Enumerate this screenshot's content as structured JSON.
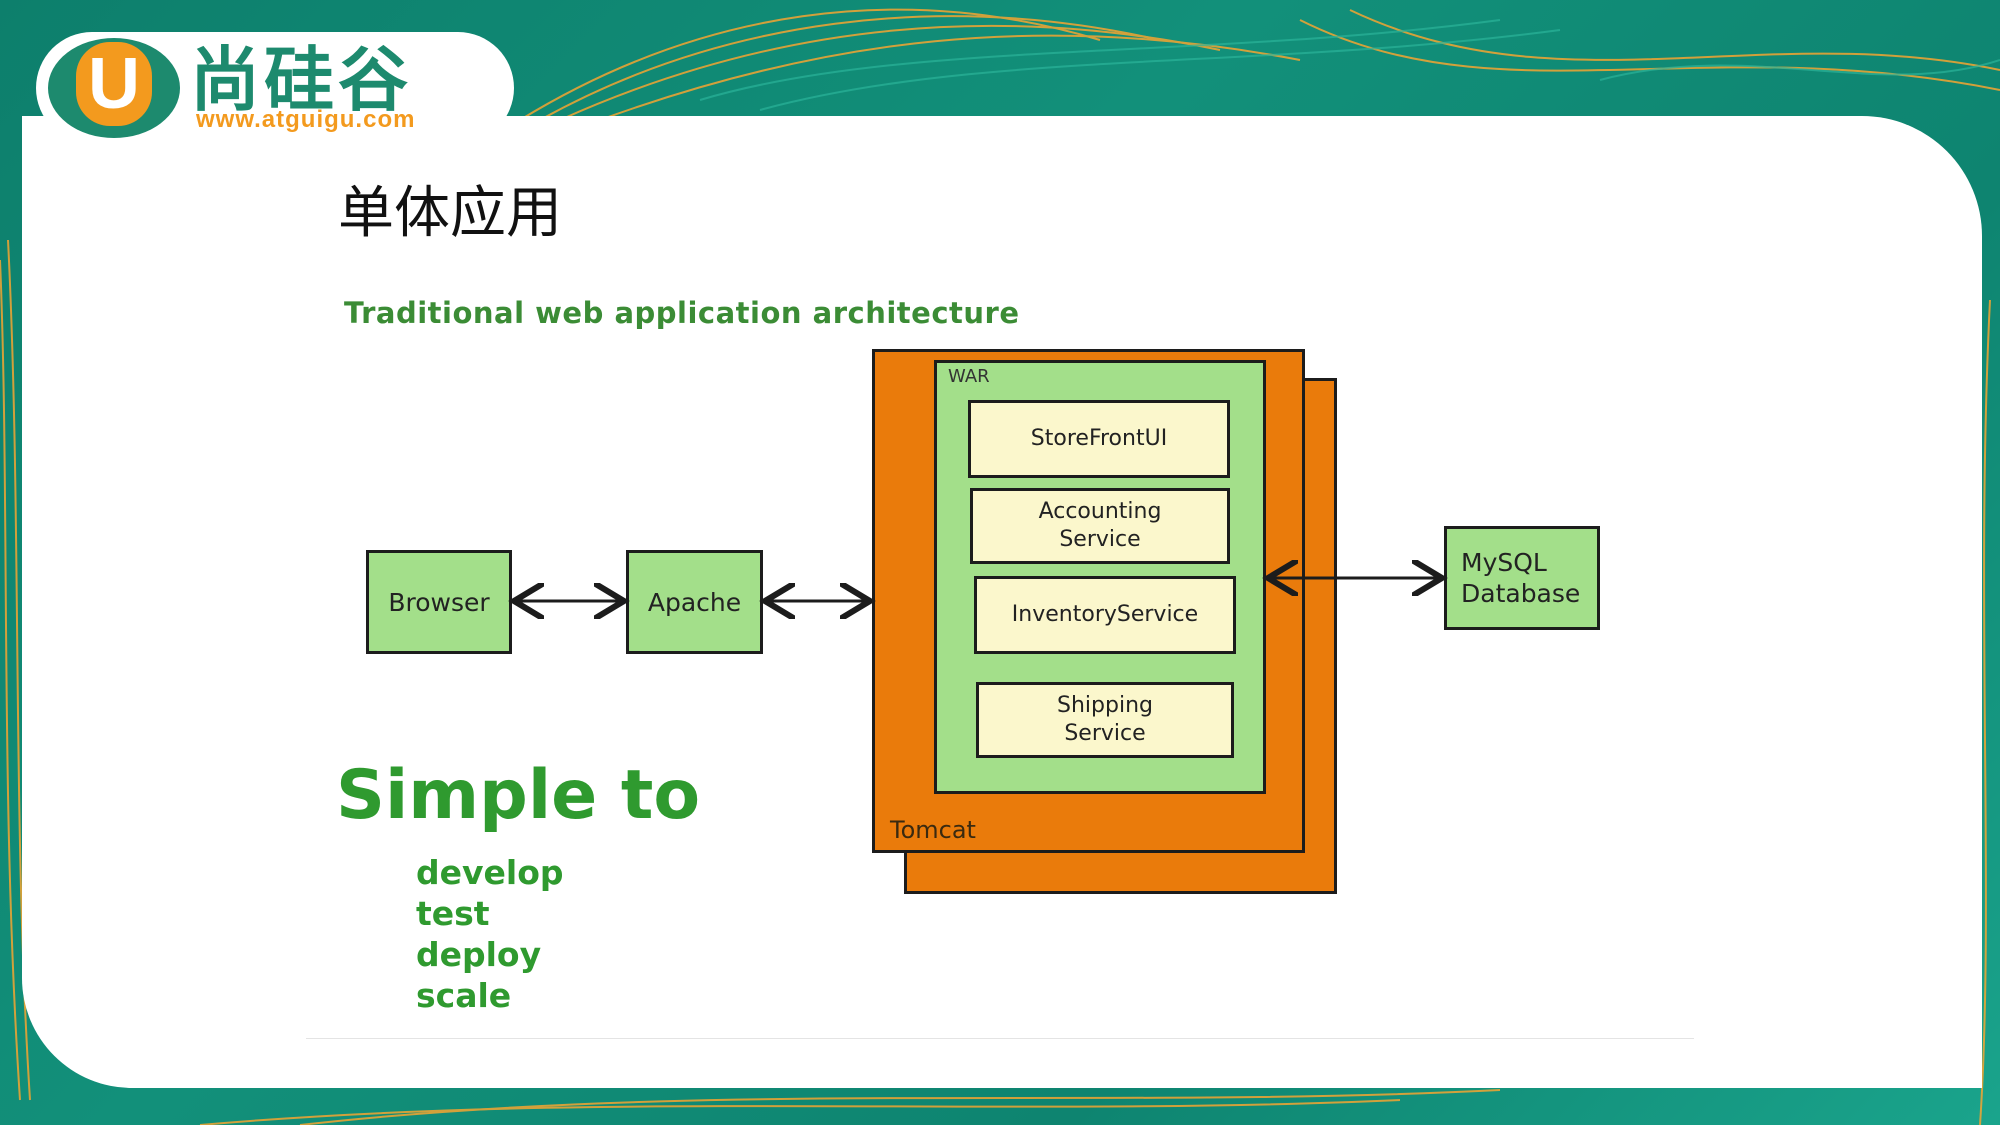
{
  "logo": {
    "letter": "U",
    "name": "尚硅谷",
    "url": "www.atguigu.com"
  },
  "page_title": "单体应用",
  "diagram": {
    "title": "Traditional web application architecture",
    "nodes": {
      "browser": "Browser",
      "apache": "Apache",
      "tomcat": "Tomcat",
      "war": "WAR",
      "mysql_line1": "MySQL",
      "mysql_line2": "Database"
    },
    "services": {
      "storefront": "StoreFrontUI",
      "accounting_line1": "Accounting",
      "accounting_line2": "Service",
      "inventory": "InventoryService",
      "shipping_line1": "Shipping",
      "shipping_line2": "Service"
    }
  },
  "simple": {
    "heading": "Simple to",
    "items": [
      "develop",
      "test",
      "deploy",
      "scale"
    ]
  },
  "colors": {
    "teal": "#0d7f6c",
    "brand_orange": "#f39a1e",
    "node_green": "#a3df8a",
    "tomcat_orange": "#ea7b0b",
    "service_cream": "#fbf7cc",
    "text_green": "#2f9a2f"
  }
}
